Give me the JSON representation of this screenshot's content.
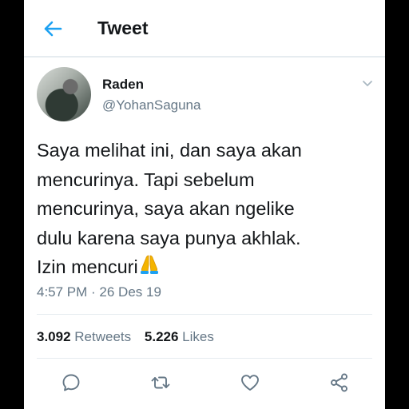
{
  "header": {
    "title": "Tweet"
  },
  "author": {
    "name": "Raden",
    "handle": "@YohanSaguna"
  },
  "tweet": {
    "lines": [
      "Saya melihat ini, dan saya akan",
      "mencurinya. Tapi sebelum",
      "mencurinya, saya akan ngelike",
      "dulu karena saya punya akhlak.",
      "Izin mencuri"
    ],
    "emoji": "folded-hands-icon",
    "timestamp": "4:57 PM · 26 Des 19"
  },
  "stats": {
    "retweets_count": "3.092",
    "retweets_label": "Retweets",
    "likes_count": "5.226",
    "likes_label": "Likes"
  },
  "colors": {
    "accent": "#1da1f2",
    "text": "#14171a",
    "secondary": "#657786",
    "divider": "#e6ecf0"
  }
}
